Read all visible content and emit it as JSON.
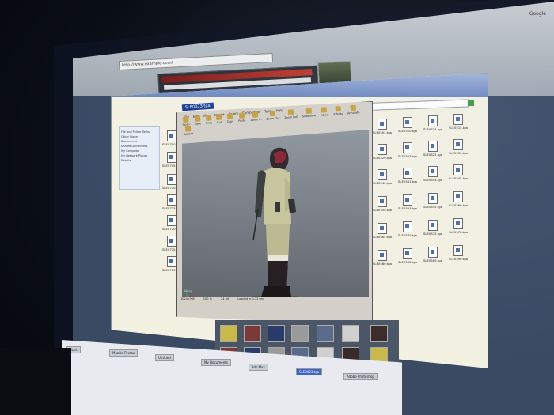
{
  "browser": {
    "search_placeholder": "Google",
    "address": "http://www.example.com/",
    "popup_field": "ucyk"
  },
  "explorer": {
    "sidebar": {
      "tasks_header": "File and Folder Tasks",
      "items": [
        "Other Places",
        "Documents",
        "Shared Documents",
        "My Computer",
        "My Network Places",
        "Details"
      ]
    },
    "left_files": [
      "SLE0700.tga",
      "SLE0705.tga",
      "SLE0710.tga",
      "SLE0715.tga",
      "SLE0720.tga",
      "SLE0725.tga",
      "SLE0730.tga"
    ],
    "grid_files": [
      [
        "SLE0503.tga",
        "SLE0510.tga",
        "SLE0514.tga",
        "SLE0515.tga"
      ],
      [
        "SLE0520.tga",
        "SLE0523.tga",
        "SLE0525.tga",
        "SLE0530.tga"
      ],
      [
        "SLE0540.tga",
        "SLE0541.tga",
        "SLE0544.tga",
        "SLE0545.tga"
      ],
      [
        "SLE0550.tga",
        "SLE0553.tga",
        "SLE0555.tga",
        "SLE0560.tga"
      ],
      [
        "SLE0565.tga",
        "SLE0570.tga",
        "SLE0575.tga",
        "SLE0578.tga"
      ],
      [
        "SLE0580.tga",
        "SLE0585.tga",
        "SLE0589.tga",
        "SLE0590.tga"
      ]
    ]
  },
  "viewer": {
    "title": "SLE0023.tga",
    "menu": [
      "File",
      "Edit",
      "View",
      "Image",
      "Colors",
      "Compositor",
      "Tools",
      "Help"
    ],
    "toolbar": [
      "Open",
      "Save",
      "Print",
      "Cut",
      "Copy",
      "Paste",
      "Zoom In",
      "Zoom Out",
      "Zoom Full",
      "Slideshow",
      "Adjust",
      "Effects",
      "Annotate",
      "Options"
    ],
    "canvas_label": "Persp",
    "status": [
      "1024x768",
      "100 %",
      "24 bit",
      "Loaded in 0.12 sec"
    ]
  },
  "taskbar": {
    "items": [
      "Start",
      "Mozilla Firefox",
      "Untitled",
      "My Documents",
      "3ds Max",
      "SLE0023.tga",
      "Adobe Photoshop"
    ],
    "active_index": 5
  },
  "colors": {
    "explorer_bg": "#f3f1e2",
    "titlebar": "#1c3f94",
    "canvas_bg": "#7a7f86",
    "screen_bg": "#3a4a63"
  }
}
